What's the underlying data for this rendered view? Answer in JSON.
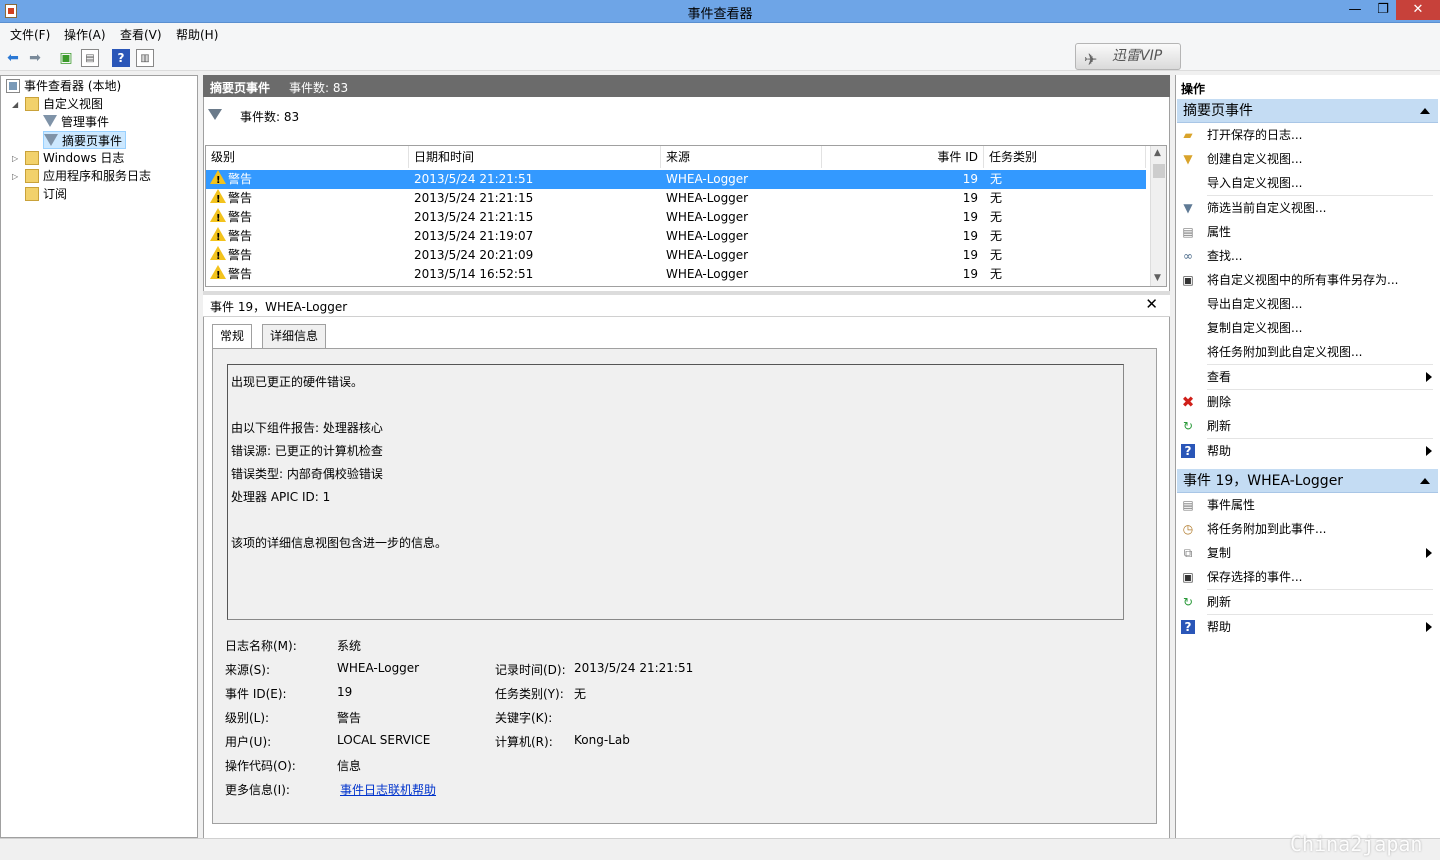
{
  "window": {
    "title": "事件查看器",
    "minimize": "—",
    "restore": "❐",
    "close": "✕"
  },
  "menu": [
    "文件(F)",
    "操作(A)",
    "查看(V)",
    "帮助(H)"
  ],
  "toolbar": {
    "vip_label": "迅雷VIP"
  },
  "tree": {
    "root": "事件查看器 (本地)",
    "custom_views": "自定义视图",
    "admin_events": "管理事件",
    "summary_events": "摘要页事件",
    "windows_logs": "Windows 日志",
    "app_service_logs": "应用程序和服务日志",
    "subscriptions": "订阅"
  },
  "center_header": {
    "title": "摘要页事件",
    "count": "事件数: 83"
  },
  "filter_count": "事件数: 83",
  "grid": {
    "columns": [
      "级别",
      "日期和时间",
      "来源",
      "事件 ID",
      "任务类别"
    ],
    "rows": [
      {
        "level": "警告",
        "datetime": "2013/5/24 21:21:51",
        "source": "WHEA-Logger",
        "id": "19",
        "category": "无"
      },
      {
        "level": "警告",
        "datetime": "2013/5/24 21:21:15",
        "source": "WHEA-Logger",
        "id": "19",
        "category": "无"
      },
      {
        "level": "警告",
        "datetime": "2013/5/24 21:21:15",
        "source": "WHEA-Logger",
        "id": "19",
        "category": "无"
      },
      {
        "level": "警告",
        "datetime": "2013/5/24 21:19:07",
        "source": "WHEA-Logger",
        "id": "19",
        "category": "无"
      },
      {
        "level": "警告",
        "datetime": "2013/5/24 20:21:09",
        "source": "WHEA-Logger",
        "id": "19",
        "category": "无"
      },
      {
        "level": "警告",
        "datetime": "2013/5/14 16:52:51",
        "source": "WHEA-Logger",
        "id": "19",
        "category": "无"
      }
    ]
  },
  "detail": {
    "title": "事件 19，WHEA-Logger",
    "tabs": [
      "常规",
      "详细信息"
    ],
    "message": [
      "出现已更正的硬件错误。",
      "由以下组件报告: 处理器核心",
      "错误源: 已更正的计算机检查",
      "错误类型: 内部奇偶校验错误",
      "处理器 APIC ID: 1",
      "该项的详细信息视图包含进一步的信息。"
    ],
    "fields": {
      "log_name_label": "日志名称(M):",
      "log_name": "系统",
      "source_label": "来源(S):",
      "source": "WHEA-Logger",
      "logged_label": "记录时间(D):",
      "logged": "2013/5/24 21:21:51",
      "event_id_label": "事件 ID(E):",
      "event_id": "19",
      "task_label": "任务类别(Y):",
      "task": "无",
      "level_label": "级别(L):",
      "level": "警告",
      "keywords_label": "关键字(K):",
      "user_label": "用户(U):",
      "user": "LOCAL SERVICE",
      "computer_label": "计算机(R):",
      "computer": "Kong-Lab",
      "opcode_label": "操作代码(O):",
      "opcode": "信息",
      "more_label": "更多信息(I):",
      "more_link": "事件日志联机帮助"
    }
  },
  "actions": {
    "header": "操作",
    "section1": "摘要页事件",
    "items1": [
      "打开保存的日志...",
      "创建自定义视图...",
      "导入自定义视图...",
      "筛选当前自定义视图...",
      "属性",
      "查找...",
      "将自定义视图中的所有事件另存为...",
      "导出自定义视图...",
      "复制自定义视图...",
      "将任务附加到此自定义视图...",
      "查看",
      "删除",
      "刷新",
      "帮助"
    ],
    "section2": "事件 19，WHEA-Logger",
    "items2": [
      "事件属性",
      "将任务附加到此事件...",
      "复制",
      "保存选择的事件...",
      "刷新",
      "帮助"
    ]
  },
  "watermark": "China2japan",
  "colors": {
    "selection": "#3399ff",
    "titlebar": "#6ea5e7",
    "section": "#c4dcf3",
    "warning": "#f3c31d"
  }
}
